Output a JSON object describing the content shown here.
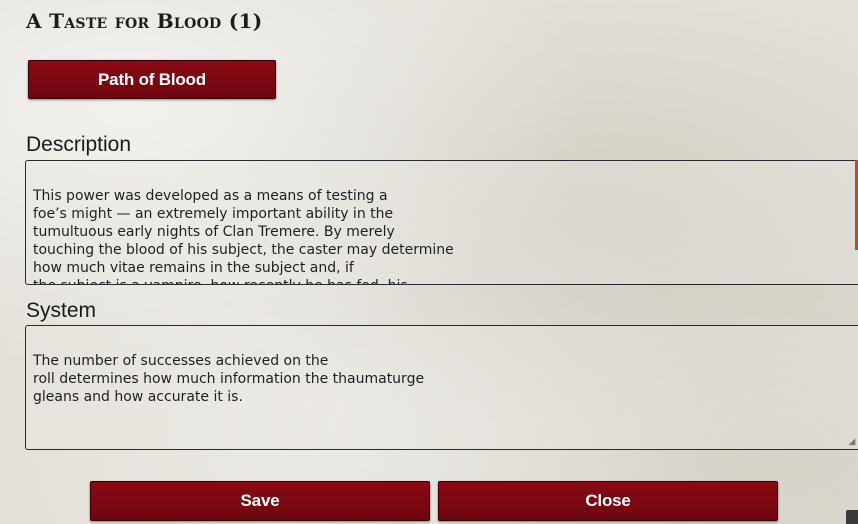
{
  "dialog": {
    "title": "A Taste for Blood (1)",
    "path_button": "Path of Blood"
  },
  "description": {
    "label": "Description",
    "text": "This power was developed as a means of testing a\nfoe’s might — an extremely important ability in the\ntumultuous early nights of Clan Tremere. By merely\ntouching the blood of his subject, the caster may determine\nhow much vitae remains in the subject and, if\nthe subject is a vampire, how recently he has fed, his\napproximate Generation and, with three or more successes"
  },
  "system": {
    "label": "System",
    "text": "The number of successes achieved on the\nroll determines how much information the thaumaturge\ngleans and how accurate it is."
  },
  "actions": {
    "save_label": "Save",
    "close_label": "Close"
  },
  "colors": {
    "button_bg": "#7a0812",
    "scroll_thumb": "#b8501c"
  }
}
